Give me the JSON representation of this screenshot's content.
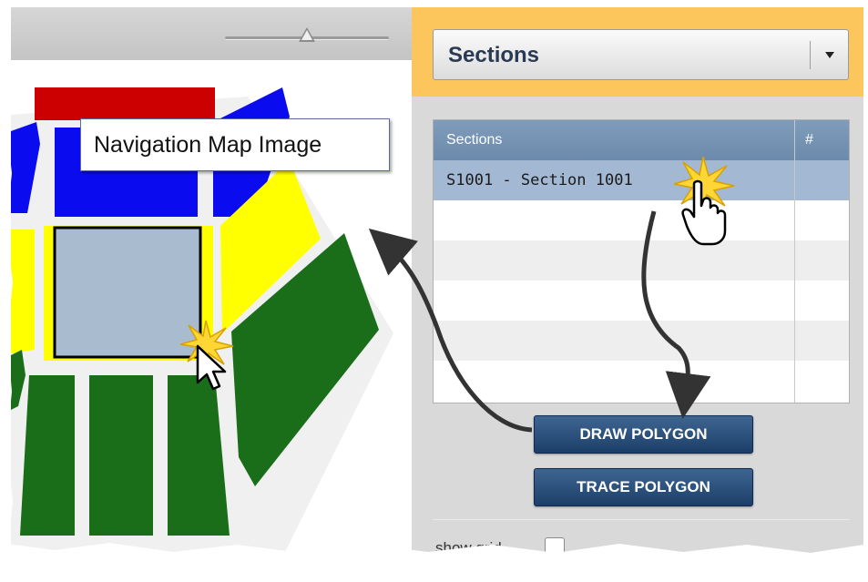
{
  "map": {
    "tooltip": "Navigation Map Image",
    "zoom_level": 0.5
  },
  "panel": {
    "dropdown_value": "Sections",
    "grid": {
      "columns": [
        "Sections",
        "#"
      ],
      "rows": [
        {
          "label": "S1001 - Section 1001",
          "count": "",
          "selected": true
        }
      ]
    },
    "draw_polygon_label": "DRAW POLYGON",
    "trace_polygon_label": "TRACE POLYGON",
    "show_grid_label": "show grid",
    "show_grid_checked": false
  },
  "colors": {
    "header_accent": "#fcc65c",
    "grid_header": "#7393b5",
    "selected_row": "#a3b8d2",
    "button": "#2a4d78",
    "section_red": "#cc0000",
    "section_blue": "#0b0bef",
    "section_yellow": "#ffff00",
    "section_green": "#1a6e1a",
    "section_selected": "#a9bccf"
  },
  "icons": [
    "slider-thumb-icon",
    "chevron-down-icon",
    "hand-pointer-icon",
    "arrow-pointer-icon",
    "click-burst-icon",
    "curved-arrow-icon"
  ]
}
